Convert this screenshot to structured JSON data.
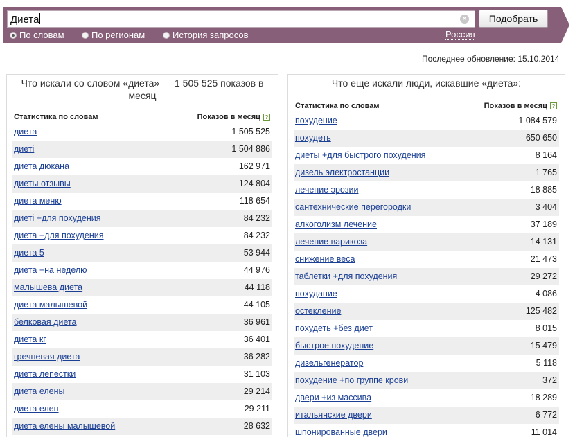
{
  "search": {
    "query": "Диета",
    "submit_label": "Подобрать",
    "modes": [
      {
        "label": "По словам",
        "checked": true
      },
      {
        "label": "По регионам",
        "checked": false
      },
      {
        "label": "История запросов",
        "checked": false
      }
    ],
    "region": "Россия"
  },
  "updated": "Последнее обновление: 15.10.2014",
  "left": {
    "title": "Что искали со словом «диета» — 1 505 525 показов в месяц",
    "col1": "Статистика по словам",
    "col2": "Показов в месяц",
    "rows": [
      {
        "phrase": "диета",
        "count": "1 505 525"
      },
      {
        "phrase": "диеті",
        "count": "1 504 886"
      },
      {
        "phrase": "диета дюкана",
        "count": "162 971"
      },
      {
        "phrase": "диеты отзывы",
        "count": "124 804"
      },
      {
        "phrase": "диета меню",
        "count": "118 654"
      },
      {
        "phrase": "диеті +для похудения",
        "count": "84 232"
      },
      {
        "phrase": "диета +для похудения",
        "count": "84 232"
      },
      {
        "phrase": "диета 5",
        "count": "53 944"
      },
      {
        "phrase": "диета +на неделю",
        "count": "44 976"
      },
      {
        "phrase": "малышева диета",
        "count": "44 118"
      },
      {
        "phrase": "диета малышевой",
        "count": "44 105"
      },
      {
        "phrase": "белковая диета",
        "count": "36 961"
      },
      {
        "phrase": "диета кг",
        "count": "36 401"
      },
      {
        "phrase": "гречневая диета",
        "count": "36 282"
      },
      {
        "phrase": "диета лепестки",
        "count": "31 103"
      },
      {
        "phrase": "диета елены",
        "count": "29 214"
      },
      {
        "phrase": "диета елен",
        "count": "29 211"
      },
      {
        "phrase": "диета елены малышевой",
        "count": "28 632"
      }
    ]
  },
  "right": {
    "title": "Что еще искали люди, искавшие «диета»:",
    "col1": "Статистика по словам",
    "col2": "Показов в месяц",
    "rows": [
      {
        "phrase": "похудение",
        "count": "1 084 579"
      },
      {
        "phrase": "похудеть",
        "count": "650 650"
      },
      {
        "phrase": "диеты +для быстрого похудения",
        "count": "8 164"
      },
      {
        "phrase": "дизель электростанции",
        "count": "1 765"
      },
      {
        "phrase": "лечение эрозии",
        "count": "18 885"
      },
      {
        "phrase": "сантехнические перегородки",
        "count": "3 404"
      },
      {
        "phrase": "алкоголизм лечение",
        "count": "37 189"
      },
      {
        "phrase": "лечение варикоза",
        "count": "14 131"
      },
      {
        "phrase": "снижение веса",
        "count": "21 473"
      },
      {
        "phrase": "таблетки +для похудения",
        "count": "29 272"
      },
      {
        "phrase": "похудание",
        "count": "4 086"
      },
      {
        "phrase": "остекление",
        "count": "125 482"
      },
      {
        "phrase": "похудеть +без диет",
        "count": "8 015"
      },
      {
        "phrase": "быстрое похудение",
        "count": "15 479"
      },
      {
        "phrase": "дизельгенератор",
        "count": "5 118"
      },
      {
        "phrase": "похудение +по группе крови",
        "count": "372"
      },
      {
        "phrase": "двери +из массива",
        "count": "18 289"
      },
      {
        "phrase": "итальянские двери",
        "count": "6 772"
      },
      {
        "phrase": "шпонированные двери",
        "count": "11 014"
      }
    ]
  },
  "icons": {
    "clear": "clear-icon",
    "help": "help-icon"
  },
  "colors": {
    "header_bg": "#875f78",
    "link": "#1b3f94",
    "zebra": "#eeeeee"
  }
}
